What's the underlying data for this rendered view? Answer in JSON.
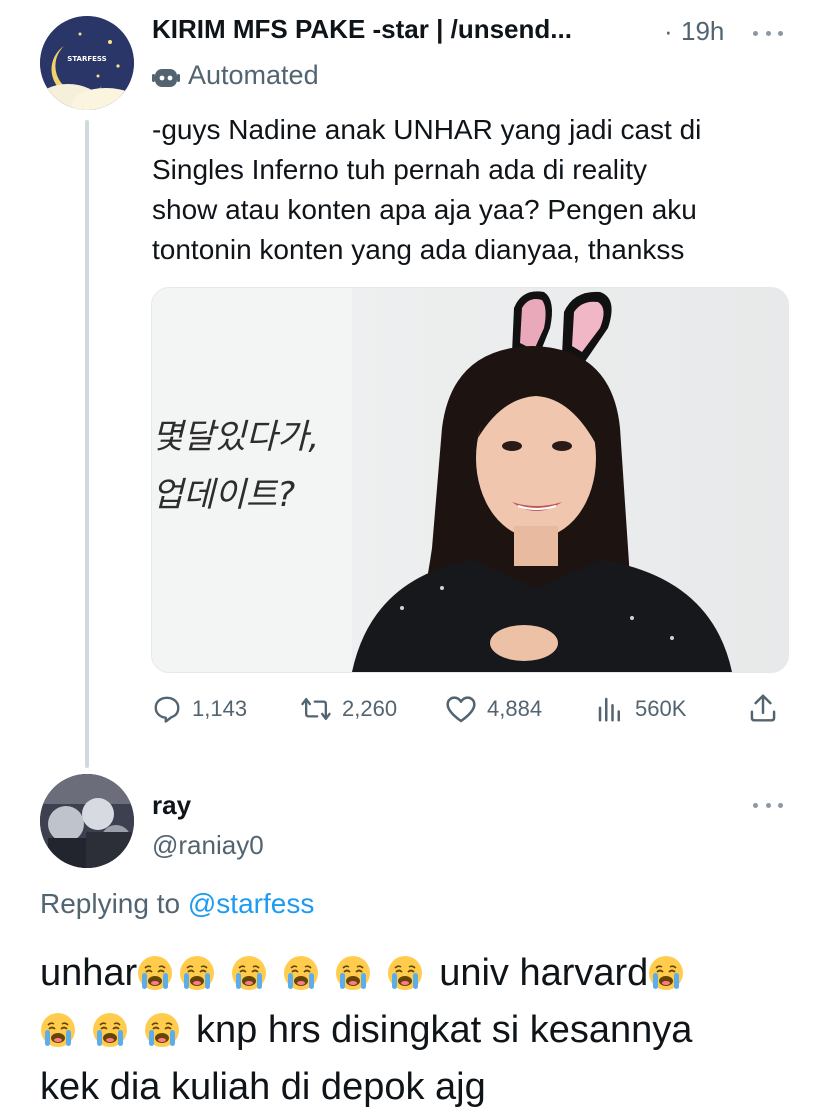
{
  "tweet": {
    "author_name": "KIRIM MFS PAKE -star | /unsend...",
    "time_separator": "·",
    "time": "19h",
    "automated_label": "Automated",
    "avatar_text": "STARFESS",
    "text_lines": [
      "-guys Nadine anak UNHAR yang jadi cast di",
      "Singles Inferno tuh pernah ada di reality",
      "show atau konten apa aja yaa? Pengen aku",
      "tontonin konten yang ada dianyaa, thankss"
    ],
    "media_caption_lines": [
      "몇달있다가,",
      "업데이트?"
    ],
    "actions": {
      "replies": "1,143",
      "retweets": "2,260",
      "likes": "4,884",
      "views": "560K"
    }
  },
  "reply": {
    "name": "ray",
    "handle": "@raniay0",
    "replying_prefix": "Replying to",
    "replying_handle": "@starfess",
    "emoji_name": "loudly-crying-face",
    "line1_word": "unhar",
    "line1_word2": "univ harvard",
    "line2_text": "knp hrs disingkat si kesannya",
    "line3_text": "kek dia kuliah di depok ajg"
  },
  "colors": {
    "text": "#0f1419",
    "secondary": "#536471",
    "link": "#1d9bf0",
    "thread_line": "#cfd9de"
  }
}
